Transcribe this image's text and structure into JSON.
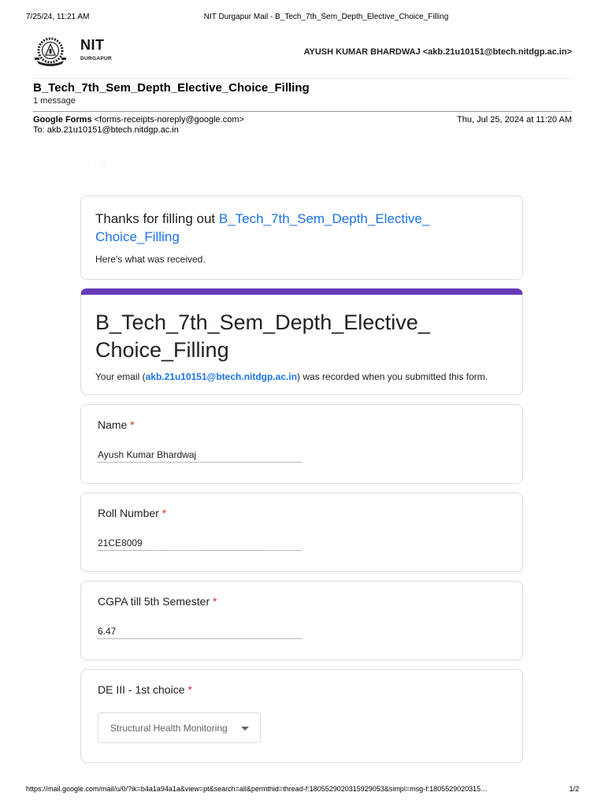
{
  "print_header": {
    "date": "7/25/24, 11:21 AM",
    "title": "NIT Durgapur Mail - B_Tech_7th_Sem_Depth_Elective_Choice_Filling"
  },
  "logo": {
    "name": "NIT",
    "subtitle": "DURGAPUR"
  },
  "account": "AYUSH KUMAR BHARDWAJ <akb.21u10151@btech.nitdgp.ac.in>",
  "subject": "B_Tech_7th_Sem_Depth_Elective_Choice_Filling",
  "message_count": "1 message",
  "sender": {
    "name": "Google Forms",
    "email": "<forms-receipts-noreply@google.com>",
    "to": "To: akb.21u10151@btech.nitdgp.ac.in",
    "date": "Thu, Jul 25, 2024 at 11:20 AM"
  },
  "thanks": {
    "prefix": "Thanks for filling out ",
    "form_name_line1": "B_Tech_7th_Sem_Depth_Elective_",
    "form_name_line2": "Choice_Filling",
    "received": "Here's what was received."
  },
  "form": {
    "title_line1": "B_Tech_7th_Sem_Depth_Elective_",
    "title_line2": "Choice_Filling",
    "email_prefix": "Your email (",
    "email": "akb.21u10151@btech.nitdgp.ac.in",
    "email_suffix": ") was recorded when you submitted this form.",
    "accent_color": "#673ab7"
  },
  "questions": [
    {
      "label": "Name",
      "required_mark": "*",
      "answer": "Ayush Kumar Bhardwaj"
    },
    {
      "label": "Roll Number",
      "required_mark": "*",
      "answer": "21CE8009"
    },
    {
      "label": "CGPA till 5th Semester",
      "required_mark": "*",
      "answer": "6.47"
    },
    {
      "label": "DE III - 1st choice",
      "required_mark": "*",
      "answer": "Structural Health Monitoring"
    }
  ],
  "print_footer": {
    "url": "https://mail.google.com/mail/u/0/?ik=b4a1a94a1a&view=pt&search=all&permthid=thread-f:1805529020315929053&simpl=msg-f:1805529020315…",
    "page": "1/2"
  }
}
